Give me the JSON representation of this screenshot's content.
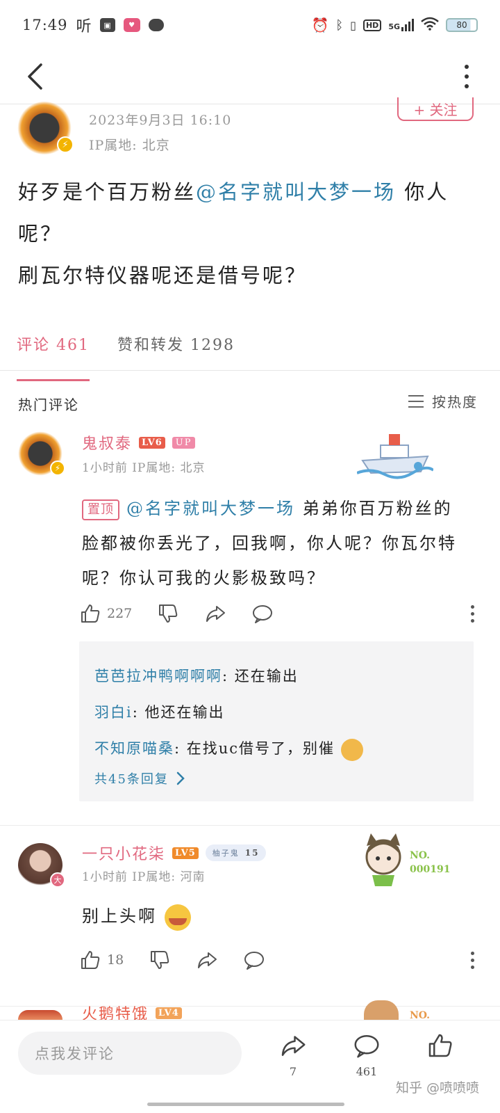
{
  "status_bar": {
    "time": "17:49",
    "app_label": "听",
    "network": "5G",
    "battery": "80"
  },
  "nav": {
    "back_label": "back",
    "more_label": "more"
  },
  "post": {
    "follow_label": "+ 关注",
    "date": "2023年9月3日 16:10",
    "ip": "IP属地: 北京",
    "text_prefix": "好歹是个百万粉丝",
    "mention": "@名字就叫大梦一场",
    "text_suffix": " 你人呢？",
    "text_line2": "刷瓦尔特仪器呢还是借号呢？"
  },
  "tabs": [
    {
      "label": "评论 461",
      "active": true
    },
    {
      "label": "赞和转发 1298",
      "active": false
    }
  ],
  "hot_comments": {
    "title": "热门评论",
    "sort_label": "按热度"
  },
  "comments": [
    {
      "name": "鬼叔泰",
      "level": "LV6",
      "up_badge": "UP",
      "meta": "1小时前 IP属地: 北京",
      "pin": "置顶",
      "mention": "@名字就叫大梦一场",
      "text": " 弟弟你百万粉丝的脸都被你丢光了，回我啊，你人呢？你瓦尔特呢？你认可我的火影极致吗？",
      "likes": "227",
      "replies": [
        {
          "name": "芭芭拉冲鸭啊啊啊",
          "text": "还在输出"
        },
        {
          "name": "羽白i",
          "text": "他还在输出"
        },
        {
          "name": "不知原喵桑",
          "text": "在找uc借号了，别催"
        }
      ],
      "more_replies": "共45条回复"
    },
    {
      "name": "一只小花柒",
      "level": "LV5",
      "fan_badge": "柚子鬼",
      "fan_level": "15",
      "deco_text": "NO.\n000191",
      "meta": "1小时前 IP属地: 河南",
      "text": "别上头啊",
      "likes": "18"
    },
    {
      "name": "火鹅特饿",
      "level": "LV4",
      "deco_text": "NO."
    }
  ],
  "bottom_bar": {
    "input_placeholder": "点我发评论",
    "share_count": "7",
    "comment_count": "461",
    "watermark": "知乎 @喷喷喷"
  }
}
